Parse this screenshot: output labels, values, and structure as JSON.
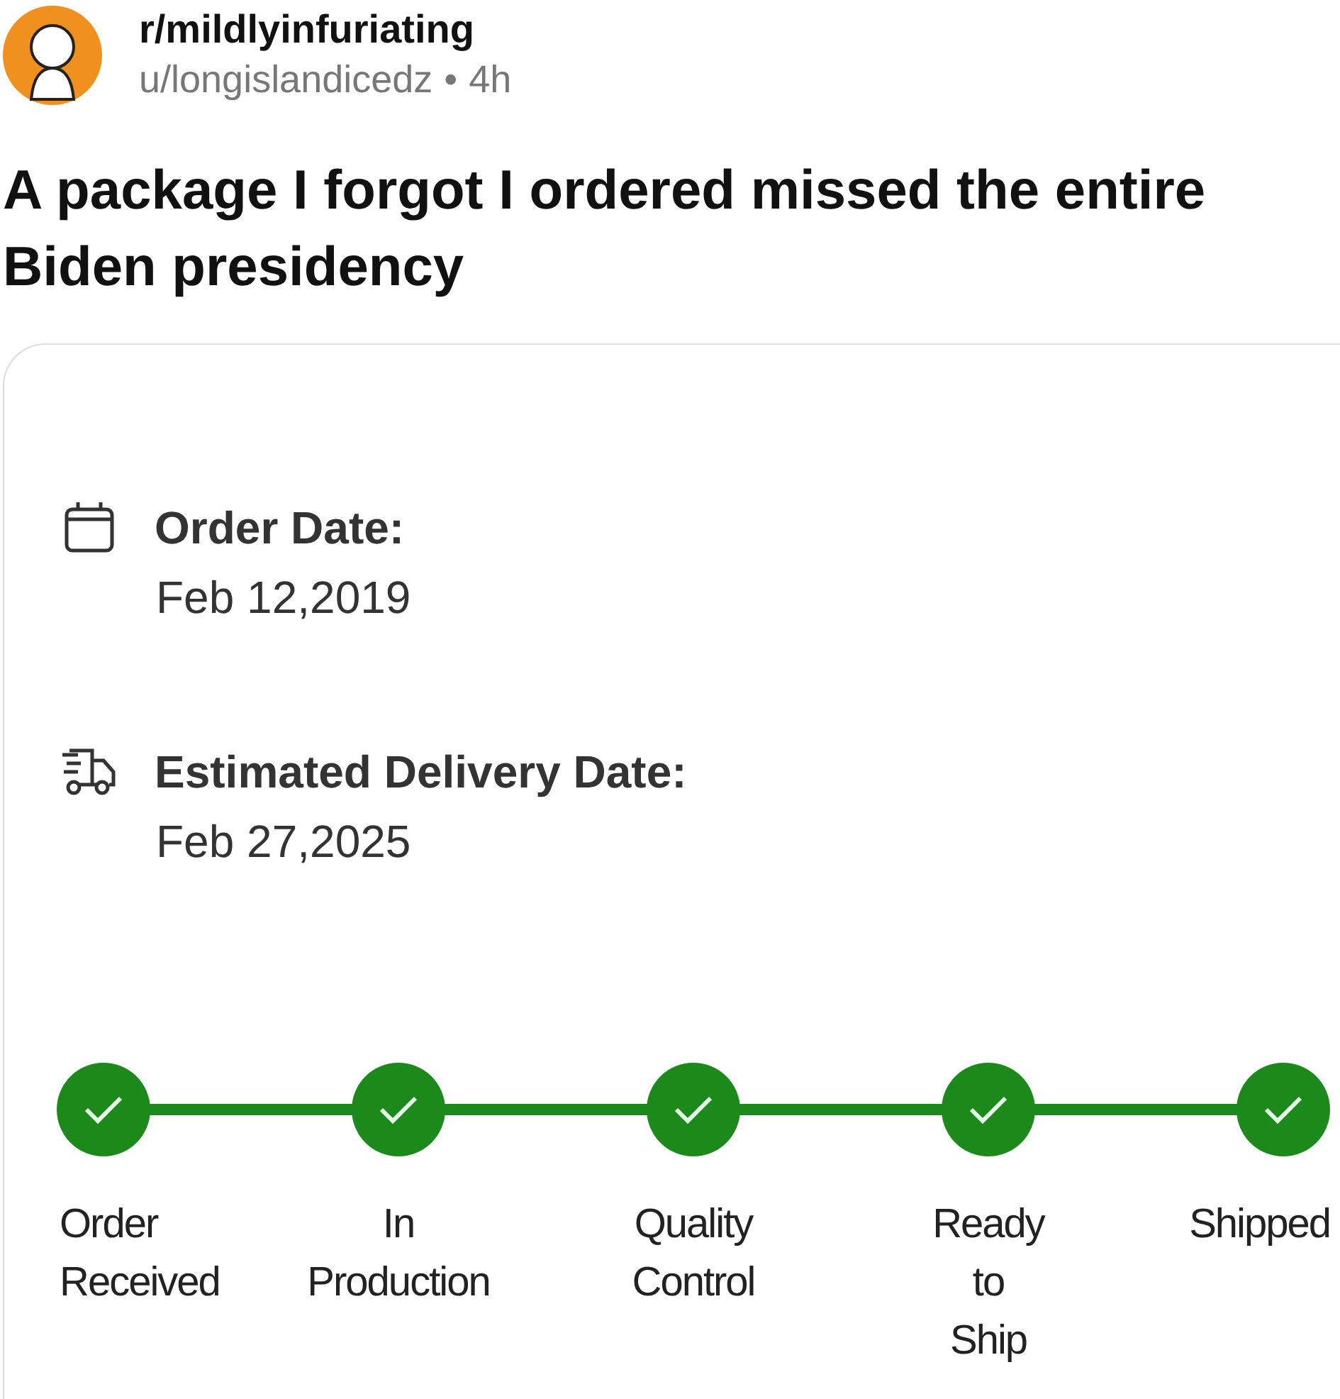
{
  "post": {
    "subreddit": "r/mildlyinfuriating",
    "author": "u/longislandicedz",
    "separator": "•",
    "age": "4h",
    "title": "A package I forgot I ordered missed the entire Biden presidency"
  },
  "order": {
    "fields": [
      {
        "kind": "calendar",
        "label": "Order Date:",
        "value": "Feb 12,2019"
      },
      {
        "kind": "truck",
        "label": "Estimated Delivery Date:",
        "value": "Feb 27,2025"
      }
    ],
    "steps": [
      {
        "label": "Order Received",
        "done": true
      },
      {
        "label": "In Production",
        "done": true
      },
      {
        "label": "Quality Control",
        "done": true
      },
      {
        "label": "Ready to Ship",
        "done": true
      },
      {
        "label": "Shipped",
        "done": true
      }
    ]
  }
}
